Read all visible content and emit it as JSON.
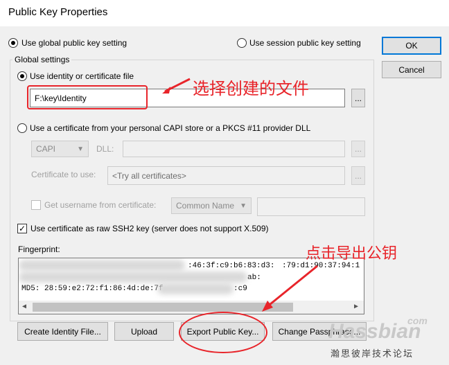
{
  "window": {
    "title": "Public Key Properties"
  },
  "buttons": {
    "ok": "OK",
    "cancel": "Cancel",
    "browse": "...",
    "create_identity": "Create Identity File...",
    "upload": "Upload",
    "export_public_key": "Export Public Key...",
    "change_passphrase": "Change Passphrase..."
  },
  "options": {
    "use_global": "Use global public key setting",
    "use_session": "Use session public key setting",
    "use_identity": "Use identity or certificate file",
    "use_capi": "Use a certificate from your personal CAPI store or a PKCS #11 provider DLL",
    "get_username": "Get username from certificate:",
    "raw_ssh2": "Use certificate as raw SSH2 key (server does not support X.509)"
  },
  "group": {
    "title": "Global settings"
  },
  "identity": {
    "path": "F:\\key\\Identity"
  },
  "capi": {
    "provider": "CAPI",
    "dll_label": "DLL:",
    "dll_value": "",
    "cert_label": "Certificate to use:",
    "cert_value": "<Try all certificates>",
    "username_source": "Common Name",
    "username_value": ""
  },
  "fingerprint": {
    "label": "Fingerprint:",
    "lines": [
      ":46:3f:c9:b6:83:d3:",
      ":79:d1:90:37:94:1",
      "ab:",
      "MD5: 28:59:e2:72:f1:86:4d:de:7f",
      ":c9"
    ]
  },
  "annotations": {
    "select_file": "选择创建的文件",
    "click_export": "点击导出公钥",
    "color": "#e8242a"
  },
  "watermark": {
    "top": "Hassbian",
    "sup": "com",
    "bottom": "瀚思彼岸技术论坛"
  }
}
